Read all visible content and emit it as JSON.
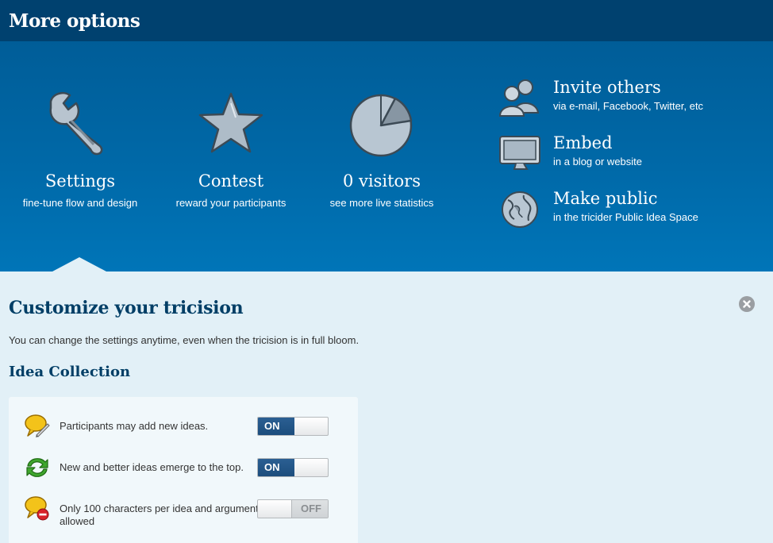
{
  "header": {
    "title": "More options"
  },
  "options": [
    {
      "title": "Settings",
      "subtitle": "fine-tune flow and design",
      "icon": "wrench-icon"
    },
    {
      "title": "Contest",
      "subtitle": "reward your participants",
      "icon": "star-icon"
    },
    {
      "title": "0 visitors",
      "subtitle": "see more live statistics",
      "icon": "pie-chart-icon"
    }
  ],
  "side_options": [
    {
      "title": "Invite others",
      "subtitle": "via e-mail, Facebook, Twitter, etc",
      "icon": "people-icon"
    },
    {
      "title": "Embed",
      "subtitle": "in a blog or website",
      "icon": "monitor-icon"
    },
    {
      "title": "Make public",
      "subtitle": "in the tricider Public Idea Space",
      "icon": "globe-icon"
    }
  ],
  "panel": {
    "title": "Customize your tricision",
    "description": "You can change the settings anytime, even when the tricision is in full bloom.",
    "section_title": "Idea Collection",
    "settings": [
      {
        "label": "Participants may add new ideas.",
        "state": "ON",
        "icon": "idea-bubble-pencil-icon"
      },
      {
        "label": "New and better ideas emerge to the top.",
        "state": "ON",
        "icon": "refresh-arrows-icon"
      },
      {
        "label": "Only 100 characters per idea and argument allowed",
        "state": "OFF",
        "icon": "idea-bubble-no-icon"
      }
    ]
  },
  "colors": {
    "header_bg": "#00416f",
    "options_bg": "#0069a8",
    "panel_bg": "#e2f0f7",
    "title_text": "#003e66",
    "toggle_on": "#1c4d7d"
  }
}
